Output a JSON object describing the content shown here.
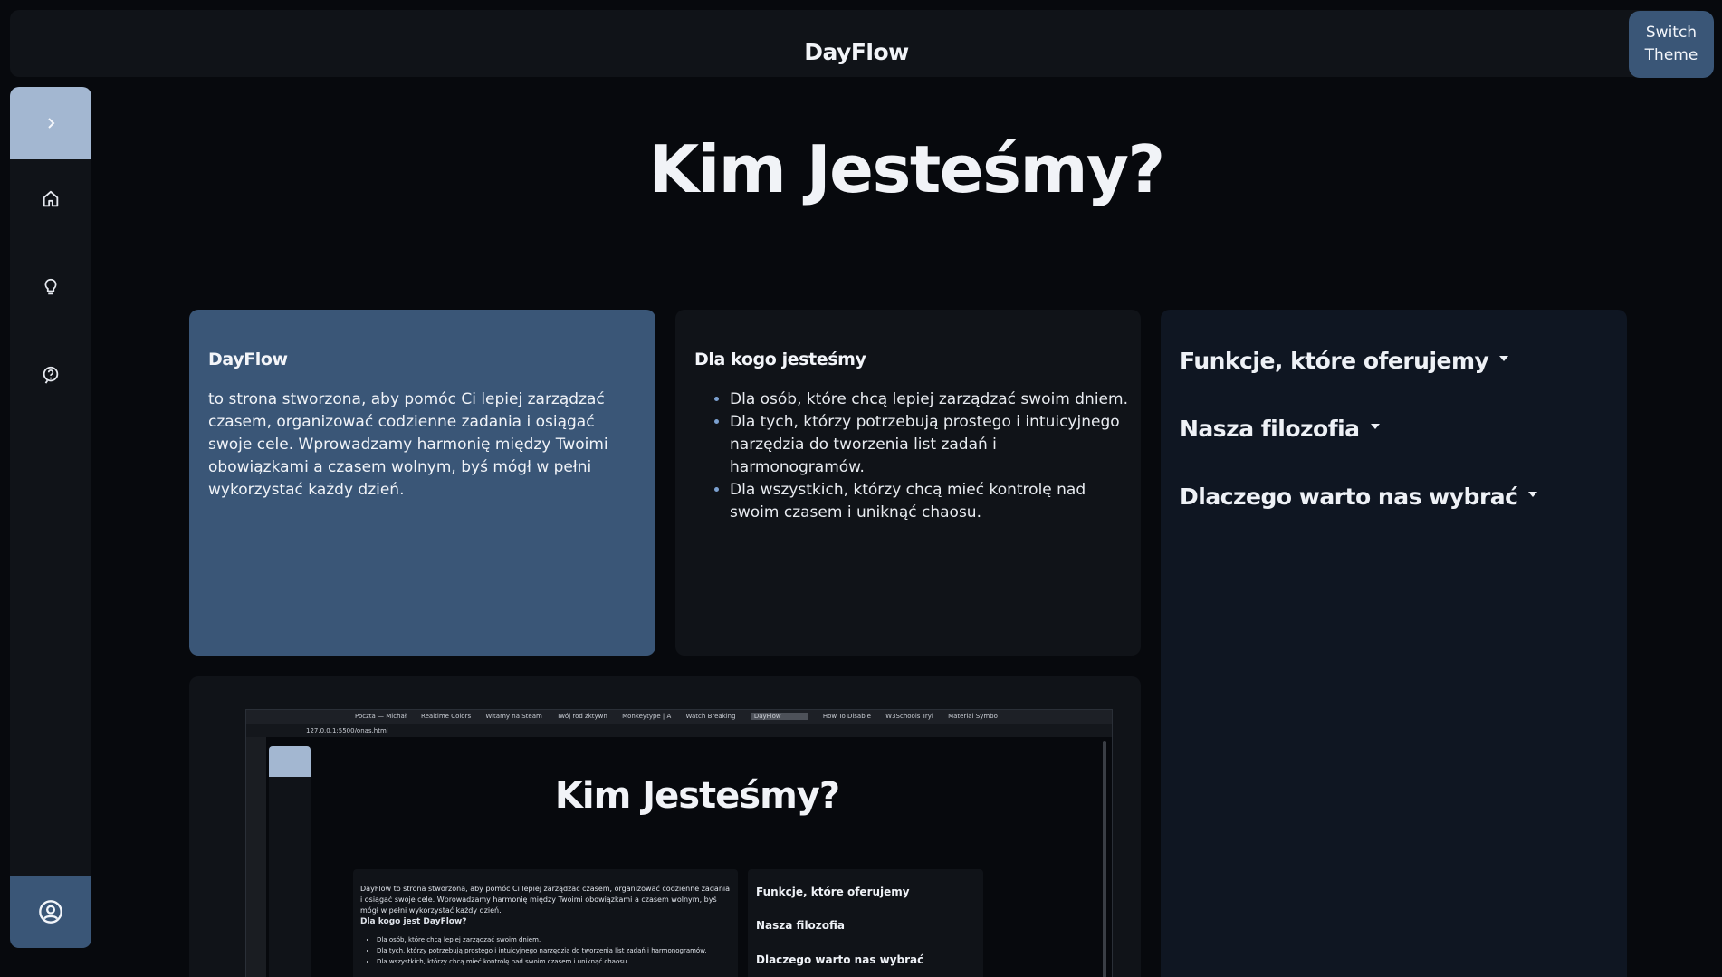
{
  "header": {
    "brand": "DayFlow",
    "theme_button": "Switch\nTheme"
  },
  "sidebar": {
    "toggle_icon": "chevron-right-icon",
    "items": [
      {
        "icon": "home-icon"
      },
      {
        "icon": "lightbulb-icon"
      },
      {
        "icon": "help-icon"
      }
    ],
    "account_icon": "account-circle-icon"
  },
  "page": {
    "title": "Kim Jesteśmy?"
  },
  "about_card": {
    "heading": "DayFlow",
    "text": "to strona stworzona, aby pomóc Ci lepiej zarządzać czasem, organizować codzienne zadania i osiągać swoje cele. Wprowadzamy harmonię między Twoimi obowiązkami a czasem wolnym, byś mógł w pełni wykorzystać każdy dzień."
  },
  "who_card": {
    "heading": "Dla kogo jesteśmy",
    "items": [
      "Dla osób, które chcą lepiej zarządzać swoim dniem.",
      "Dla tych, którzy potrzebują prostego i intuicyjnego narzędzia do tworzenia list zadań i harmonogramów.",
      "Dla wszystkich, którzy chcą mieć kontrolę nad swoim czasem i uniknąć chaosu."
    ]
  },
  "accordion": {
    "items": [
      "Funkcje, które oferujemy",
      "Nasza filozofia",
      "Dlaczego warto nas wybrać"
    ]
  },
  "screenshot": {
    "tabs": [
      "Poczta — Michał",
      "Realtime Colors",
      "Witamy na Steam",
      "Twój rod zktywn",
      "Monkeytype | A",
      "Watch Breaking",
      "DayFlow",
      "How To Disable",
      "W3Schools Tryi",
      "Material Symbo"
    ],
    "url": "127.0.0.1:5500/onas.html",
    "title": "Kim Jesteśmy?",
    "about_text": "DayFlow to strona stworzona, aby pomóc Ci lepiej zarządzać czasem, organizować codzienne zadania i osiągać swoje cele. Wprowadzamy harmonię między Twoimi obowiązkami a czasem wolnym, byś mógł w pełni wykorzystać każdy dzień.",
    "who_heading": "Dla kogo jest DayFlow?",
    "who_items": [
      "Dla osób, które chcą lepiej zarządzać swoim dniem.",
      "Dla tych, którzy potrzebują prostego i intuicyjnego narzędzia do tworzenia list zadań i harmonogramów.",
      "Dla wszystkich, którzy chcą mieć kontrolę nad swoim czasem i uniknąć chaosu."
    ],
    "acc_items": [
      "Funkcje, które oferujemy",
      "Nasza filozofia",
      "Dlaczego warto nas wybrać"
    ]
  }
}
